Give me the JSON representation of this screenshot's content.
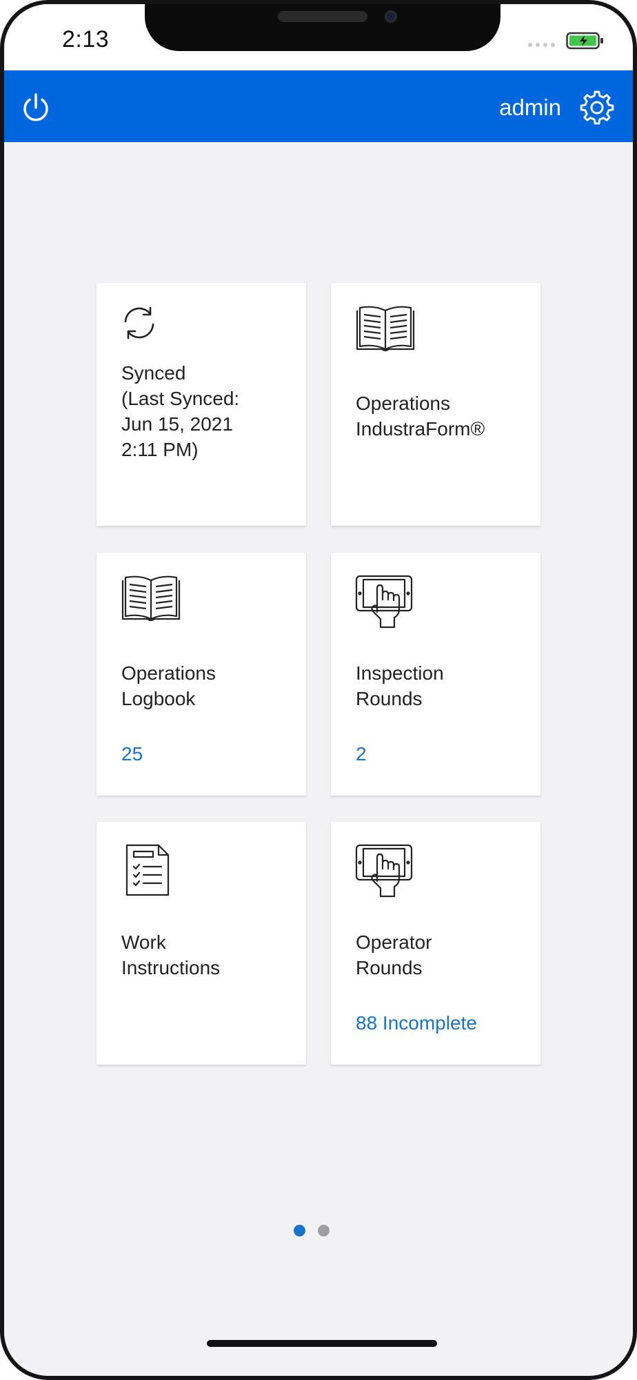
{
  "status_bar": {
    "time": "2:13"
  },
  "header": {
    "user": "admin",
    "power_icon": "power-icon",
    "settings_icon": "gear-icon",
    "color": "#0066dd"
  },
  "tiles": [
    {
      "icon": "sync-icon",
      "label": "Synced\n(Last Synced:\nJun 15, 2021\n2:11 PM)",
      "count": ""
    },
    {
      "icon": "open-book-icon",
      "label": "Operations\nIndustraForm®",
      "count": ""
    },
    {
      "icon": "open-book-icon",
      "label": "Operations\nLogbook",
      "count": "25"
    },
    {
      "icon": "tablet-touch-icon",
      "label": "Inspection\nRounds",
      "count": "2"
    },
    {
      "icon": "checklist-icon",
      "label": "Work\nInstructions",
      "count": ""
    },
    {
      "icon": "tablet-touch-icon",
      "label": "Operator\nRounds",
      "count": "88 Incomplete"
    }
  ],
  "pagination": {
    "pages": 2,
    "current": 1,
    "active_color": "#1a73c8",
    "inactive_color": "#9e9e9e"
  },
  "colors": {
    "accent": "#0066dd",
    "count_text": "#1a73c8",
    "background": "#f2f2f4"
  }
}
